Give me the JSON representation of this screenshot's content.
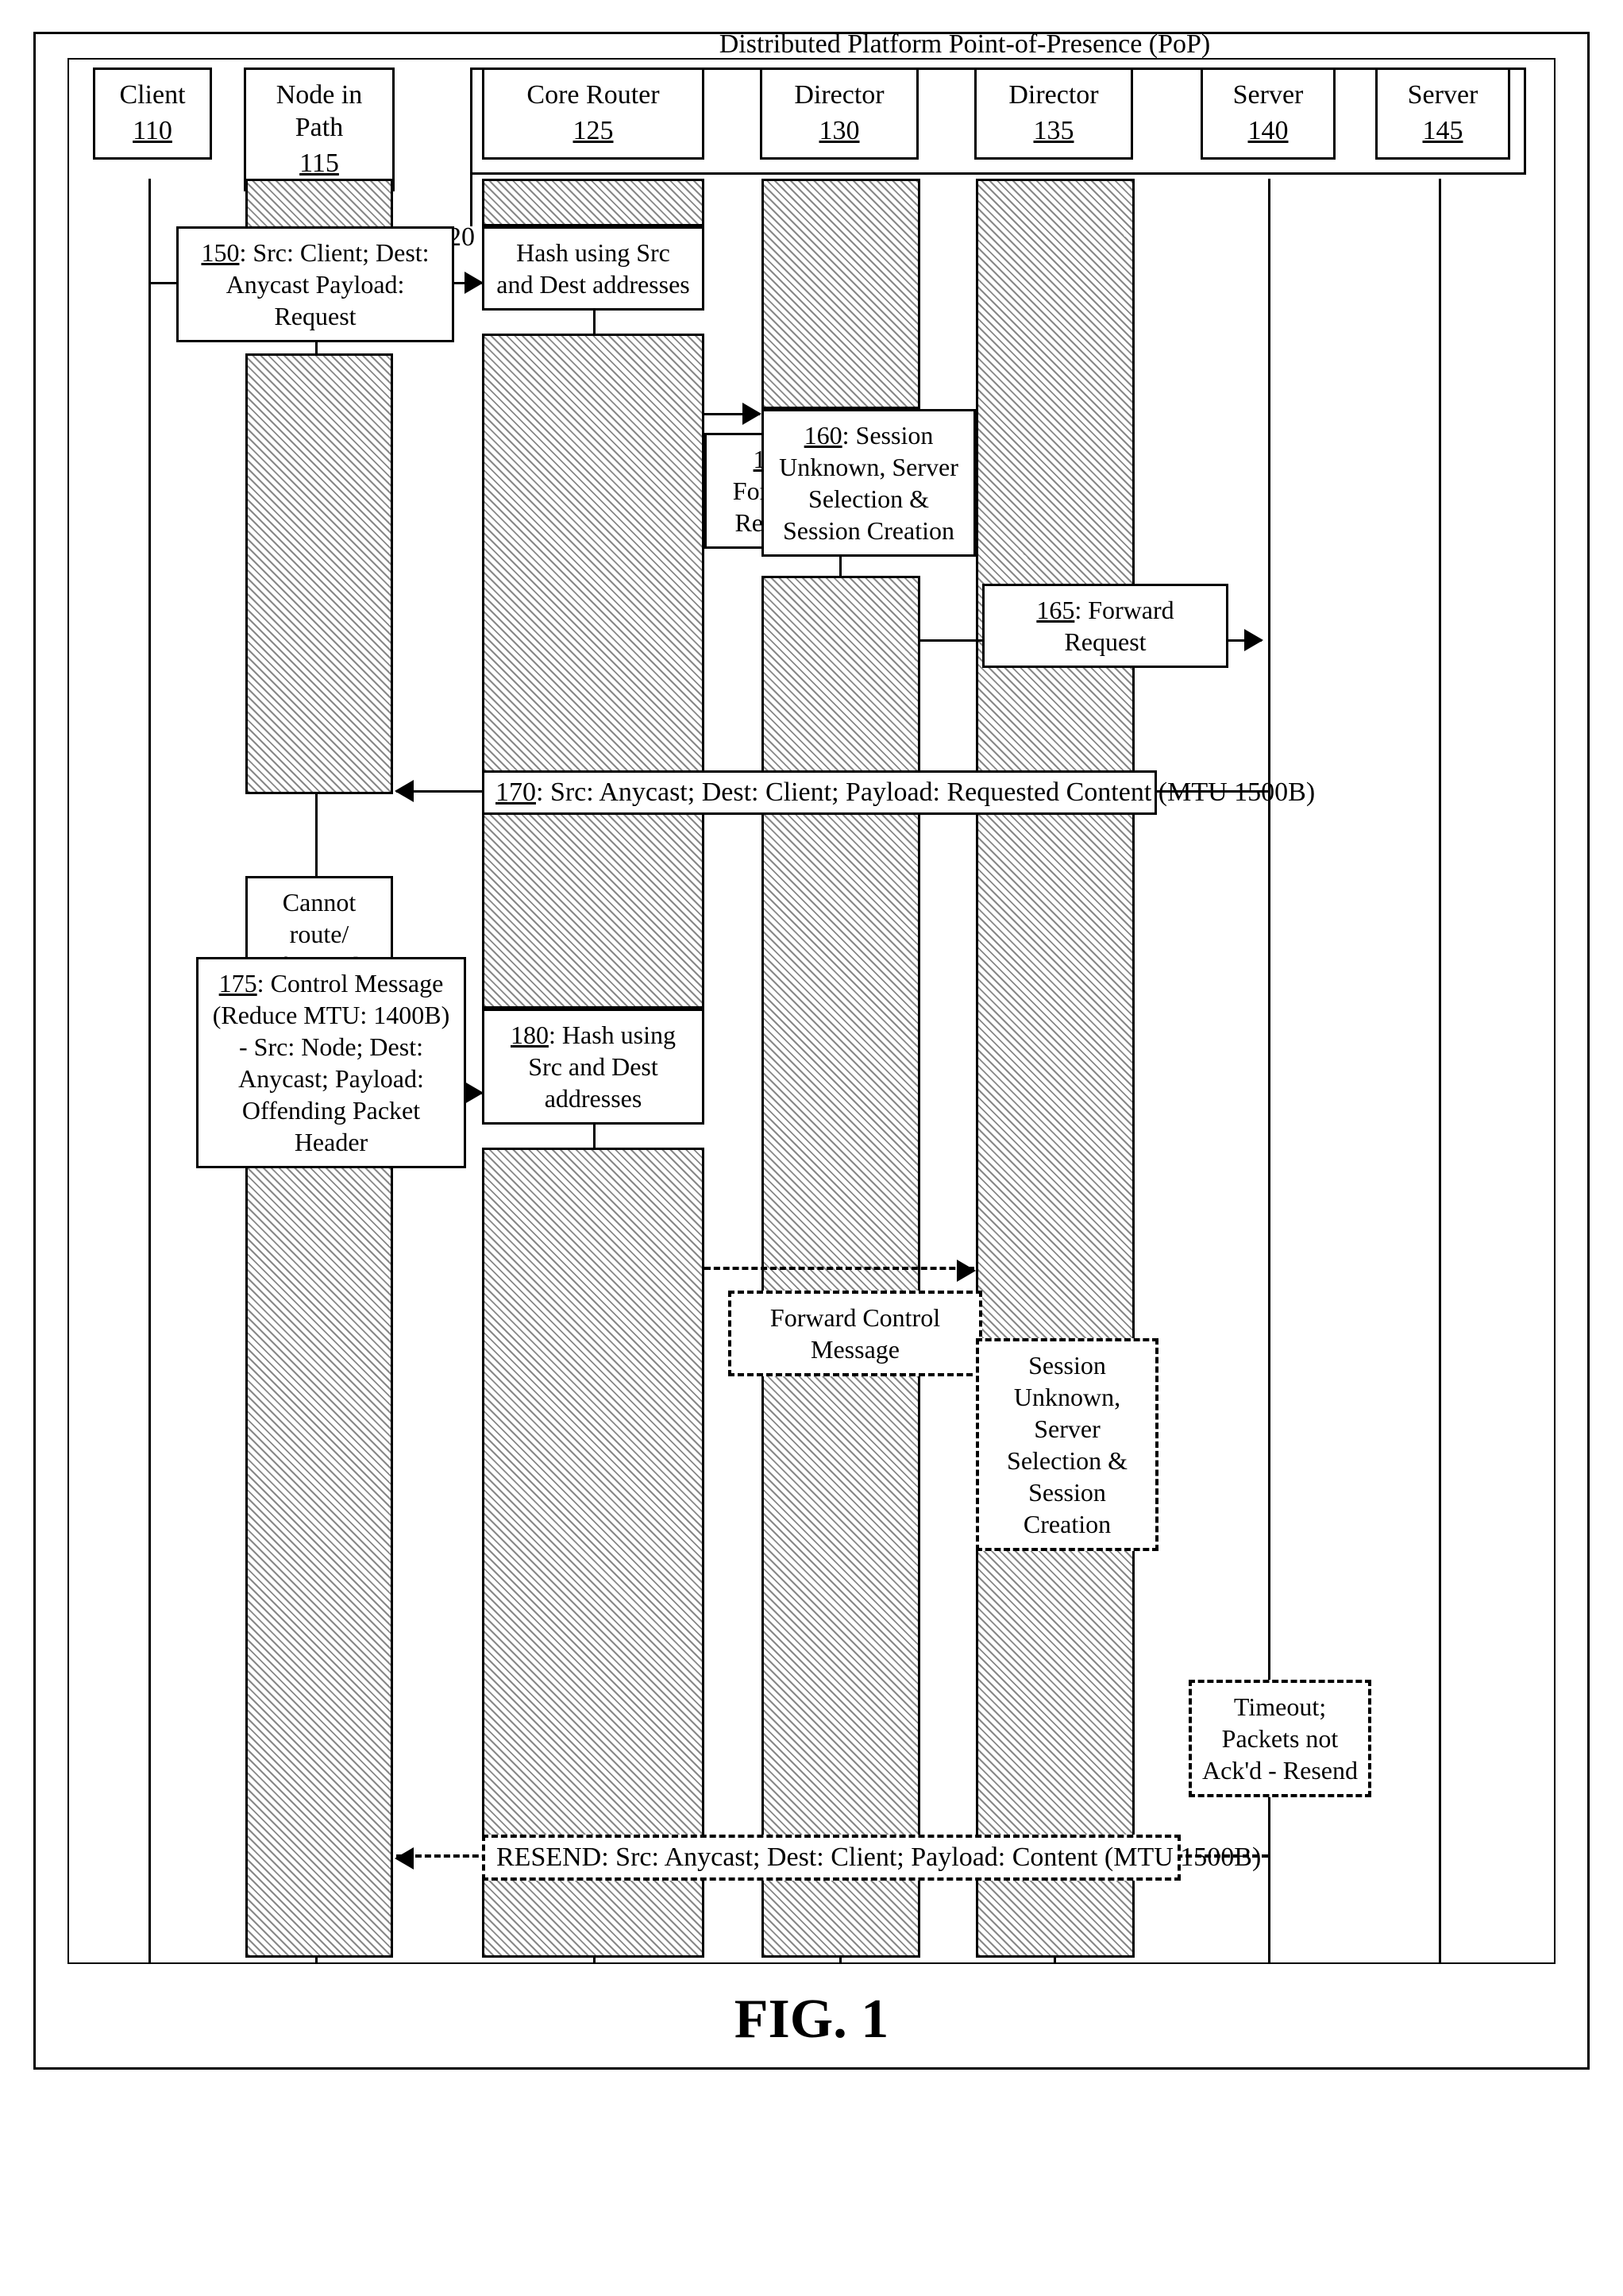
{
  "pop_label": "Distributed Platform Point-of-Presence (PoP)",
  "pop_ref": "120",
  "headers": {
    "client": {
      "label": "Client",
      "num": "110"
    },
    "node": {
      "label": "Node in Path",
      "num": "115"
    },
    "core_router": {
      "label": "Core Router",
      "num": "125"
    },
    "director1": {
      "label": "Director",
      "num": "130"
    },
    "director2": {
      "label": "Director",
      "num": "135"
    },
    "server1": {
      "label": "Server",
      "num": "140"
    },
    "server2": {
      "label": "Server",
      "num": "145"
    }
  },
  "msg150": {
    "num": "150",
    "text": ": Src: Client; Dest: Anycast Payload: Request"
  },
  "note_hash1": "Hash using Src and Dest addresses",
  "msg155": {
    "num": "155",
    "text": ": Forward Request"
  },
  "msg160": {
    "num": "160",
    "text": ": Session Unknown, Server Selection & Session Creation"
  },
  "msg165": {
    "num": "165",
    "text": ": Forward Request"
  },
  "msg170": {
    "num": "170",
    "text": ": Src: Anycast; Dest: Client; Payload: Requested Content (MTU 1500B)"
  },
  "note_cannot": "Cannot route/ forward packets",
  "msg175": {
    "num": "175",
    "text": ": Control Message (Reduce MTU: 1400B) - Src: Node; Dest: Anycast; Payload: Offending Packet Header"
  },
  "msg180": {
    "num": "180",
    "text": ": Hash using Src and Dest addresses"
  },
  "note_fwdctl": "Forward Control Message",
  "note_sess2": "Session Unknown, Server Selection & Session Creation",
  "note_timeout": "Timeout; Packets not Ack'd - Resend",
  "msg_resend": "RESEND: Src: Anycast; Dest: Client; Payload: Content (MTU 1500B)",
  "figcaption": "FIG. 1"
}
